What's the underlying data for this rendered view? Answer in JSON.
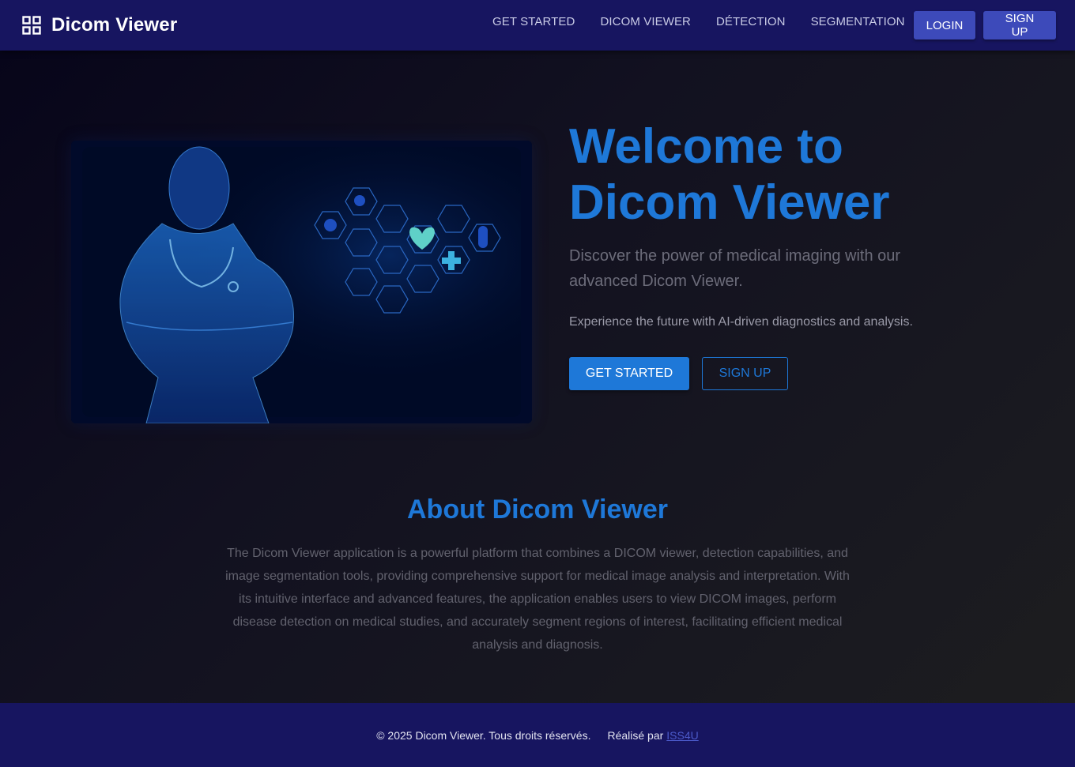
{
  "header": {
    "title": "Dicom Viewer",
    "logo_icon": "grid-icon",
    "nav": [
      "GET STARTED",
      "DICOM VIEWER",
      "DÉTECTION",
      "SEGMENTATION"
    ],
    "login_label": "LOGIN",
    "signup_label": "SIGN UP"
  },
  "hero": {
    "image_alt": "doctor-hologram-illustration",
    "title_line1": "Welcome to",
    "title_line2": "Dicom Viewer",
    "subtitle": "Discover the power of medical imaging with our advanced Dicom Viewer.",
    "description": "Experience the future with AI-driven diagnostics and analysis.",
    "primary_button": "GET STARTED",
    "secondary_button": "SIGN UP"
  },
  "about": {
    "title": "About Dicom Viewer",
    "text": "The Dicom Viewer application is a powerful platform that combines a DICOM viewer, detection capabilities, and image segmentation tools, providing comprehensive support for medical image analysis and interpretation. With its intuitive interface and advanced features, the application enables users to view DICOM images, perform disease detection on medical studies, and accurately segment regions of interest, facilitating efficient medical analysis and diagnosis."
  },
  "footer": {
    "copyright": "© 2025 Dicom Viewer. Tous droits réservés.",
    "made_by_label": "Réalisé par",
    "made_by_link": "ISS4U"
  },
  "colors": {
    "header_bg": "#171560",
    "accent": "#1e78d8",
    "button_head": "#3d4aba"
  }
}
